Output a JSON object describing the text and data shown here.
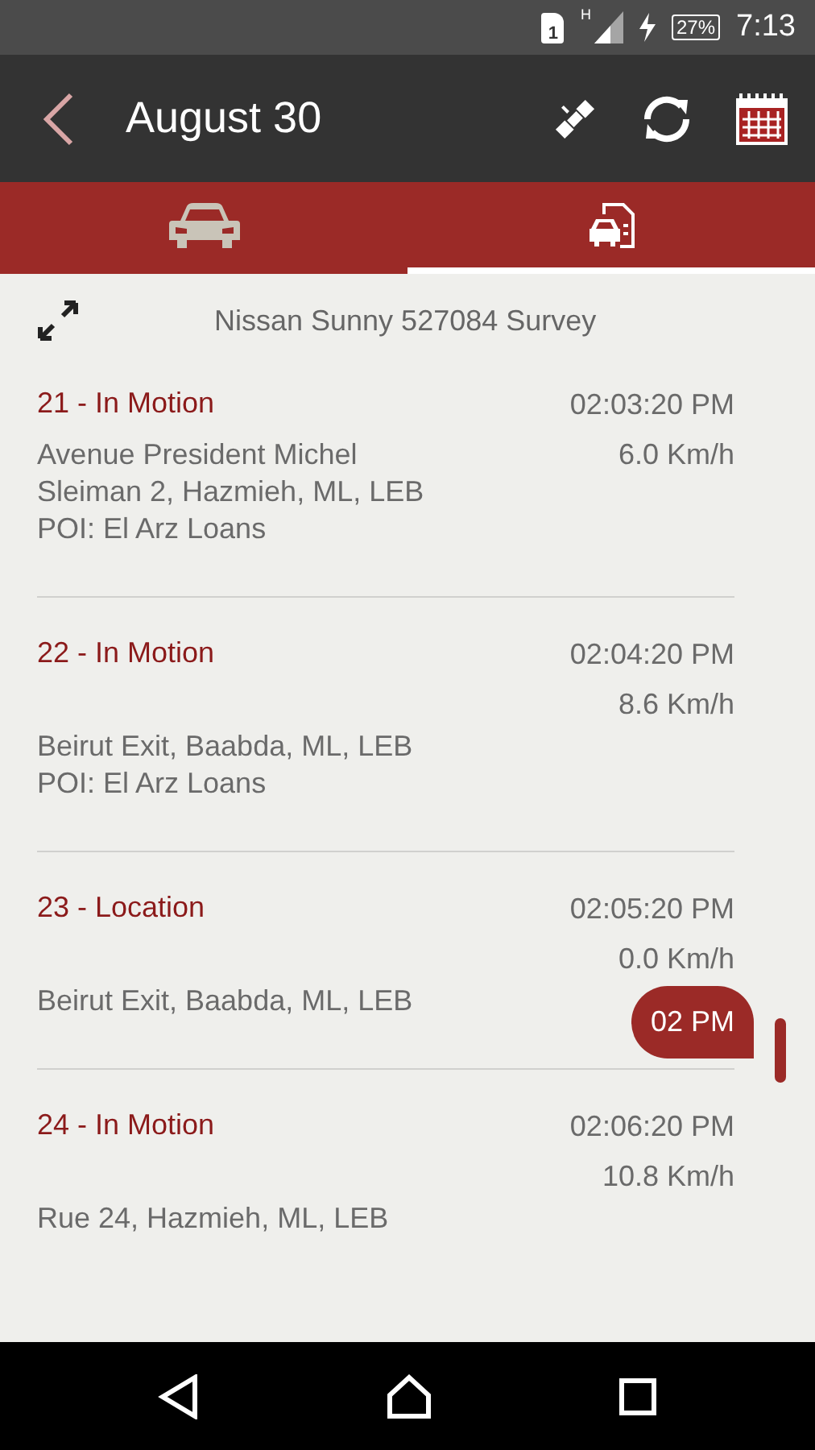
{
  "status_bar": {
    "sim": "1",
    "network": "H",
    "battery": "27%",
    "time": "7:13"
  },
  "toolbar": {
    "title": "August 30"
  },
  "tabs": [
    {
      "kind": "car",
      "selected": false
    },
    {
      "kind": "report",
      "selected": true
    }
  ],
  "vehicle": "Nissan Sunny 527084 Survey",
  "entries": [
    {
      "title": "21 - In Motion",
      "time": "02:03:20 PM",
      "speed": "6.0 Km/h",
      "address": "Avenue President Michel Sleiman 2, Hazmieh, ML, LEB",
      "poi": "POI: El Arz Loans"
    },
    {
      "title": "22 - In Motion",
      "time": "02:04:20 PM",
      "speed": "8.6 Km/h",
      "address": "Beirut Exit, Baabda, ML, LEB",
      "poi": "POI: El Arz Loans"
    },
    {
      "title": "23 - Location",
      "time": "02:05:20 PM",
      "speed": "0.0 Km/h",
      "address": "Beirut Exit, Baabda, ML, LEB"
    },
    {
      "title": "24 - In Motion",
      "time": "02:06:20 PM",
      "speed": "10.8 Km/h",
      "address": "Rue 24, Hazmieh, ML, LEB"
    }
  ],
  "scroll_bubble": "02 PM"
}
